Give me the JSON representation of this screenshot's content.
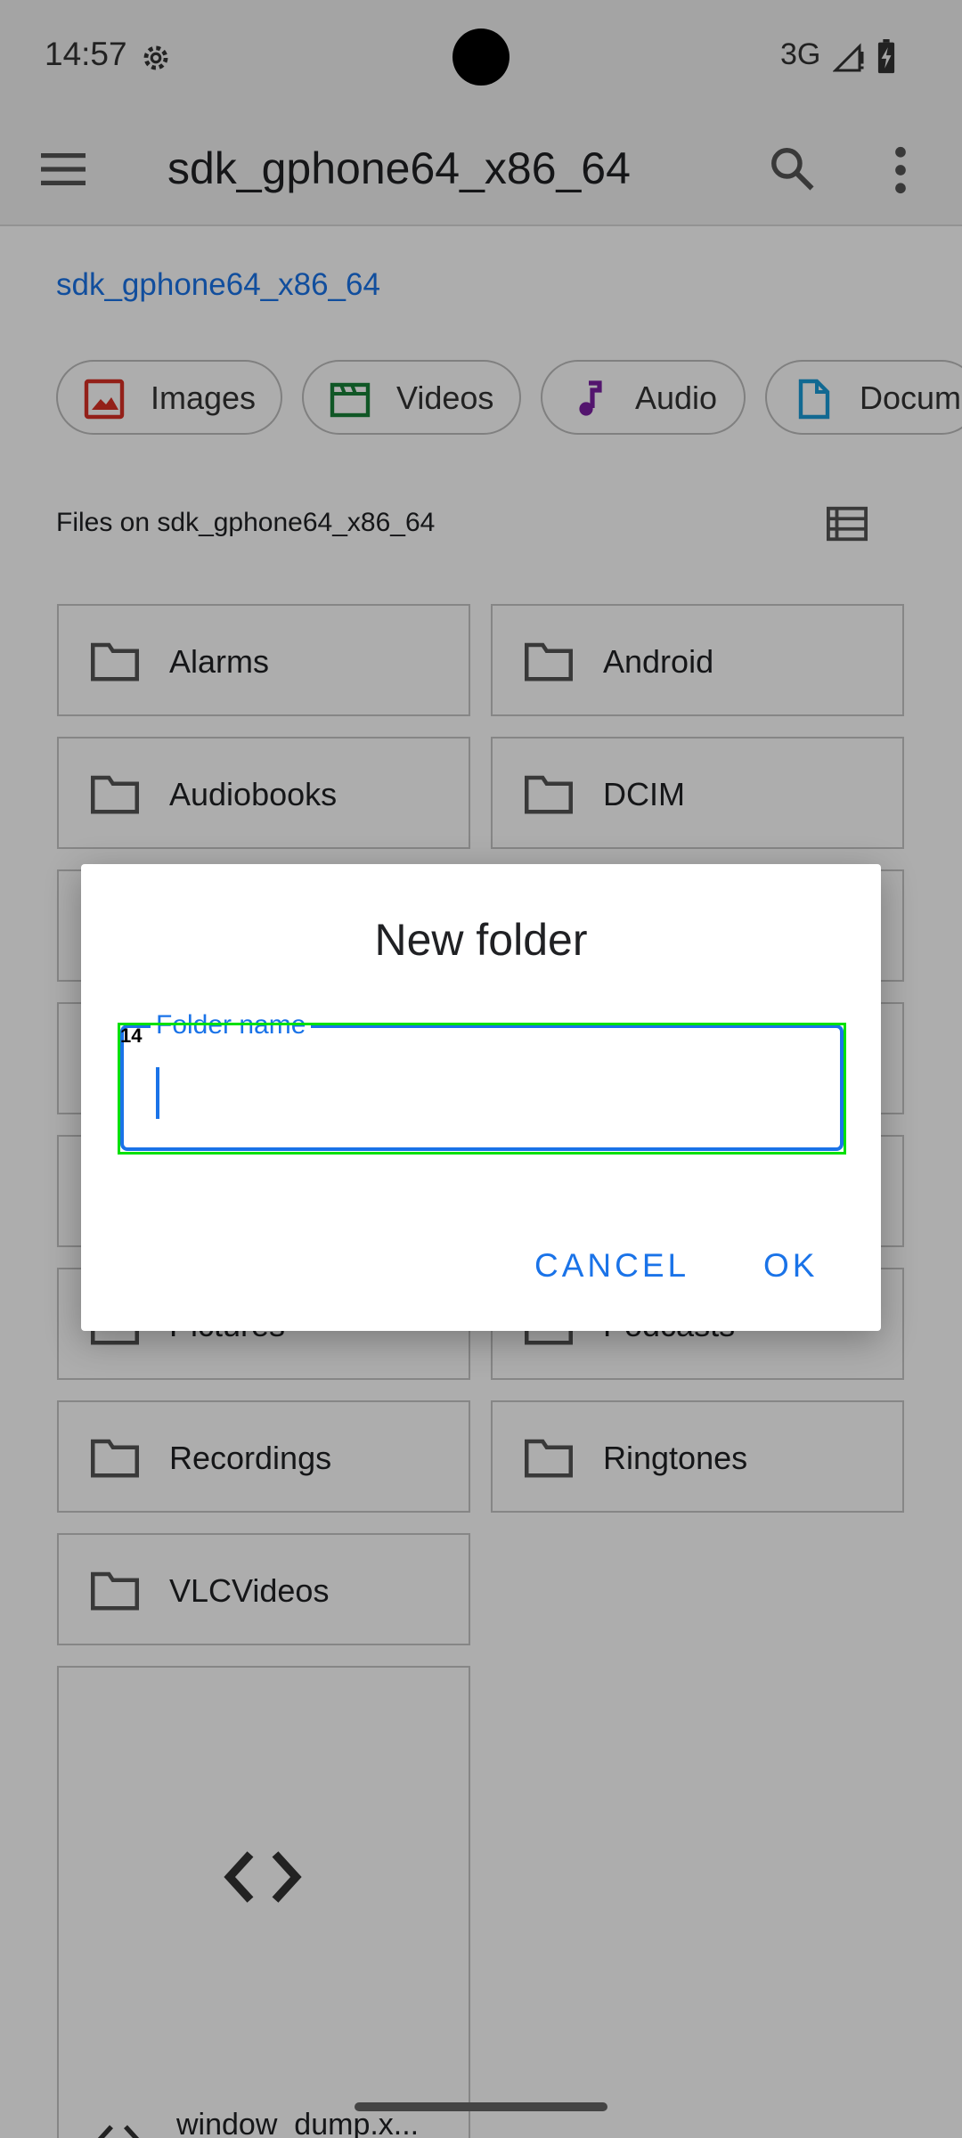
{
  "status_bar": {
    "time": "14:57",
    "network": "3G"
  },
  "app_bar": {
    "title": "sdk_gphone64_x86_64"
  },
  "breadcrumb": "sdk_gphone64_x86_64",
  "chips": [
    {
      "label": "Images",
      "icon": "image-icon",
      "color": "#d93025"
    },
    {
      "label": "Videos",
      "icon": "video-icon",
      "color": "#188038"
    },
    {
      "label": "Audio",
      "icon": "music-note-icon",
      "color": "#7b1fa2"
    },
    {
      "label": "Docume",
      "icon": "document-icon",
      "color": "#1a9bd7"
    }
  ],
  "section_label": "Files on sdk_gphone64_x86_64",
  "folders": [
    {
      "name": "Alarms"
    },
    {
      "name": "Android"
    },
    {
      "name": "Audiobooks"
    },
    {
      "name": "DCIM"
    },
    {
      "name": "Pictures"
    },
    {
      "name": "Podcasts"
    },
    {
      "name": "Recordings"
    },
    {
      "name": "Ringtones"
    },
    {
      "name": "VLCVideos"
    }
  ],
  "file_card": {
    "name": "window_dump.x..."
  },
  "dialog": {
    "title": "New folder",
    "field_label": "Folder name",
    "field_value": "",
    "focus_tag": "14",
    "cancel": "CANCEL",
    "ok": "OK"
  },
  "colors": {
    "accent": "#1a73e8",
    "focus_outline": "#00e000"
  }
}
